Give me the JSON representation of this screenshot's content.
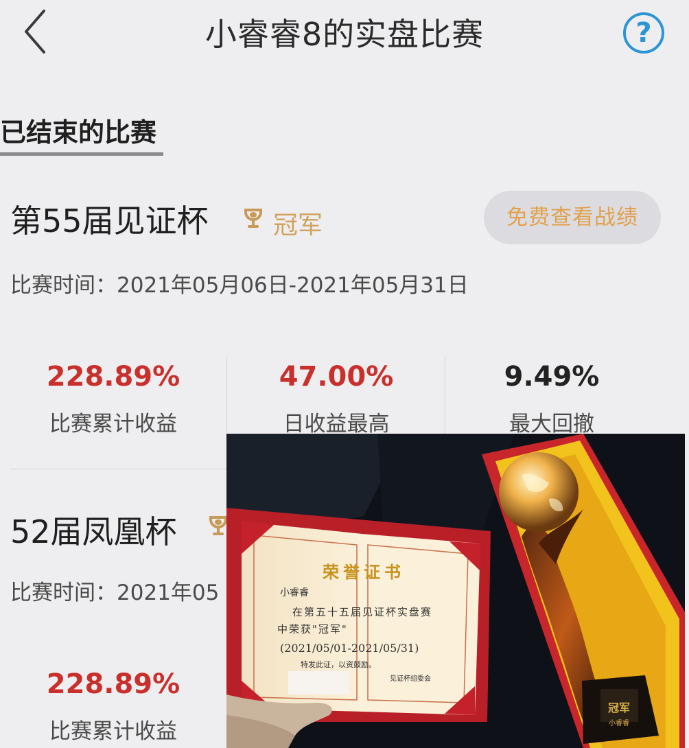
{
  "header": {
    "title": "小睿睿8的实盘比赛",
    "help_label": "?"
  },
  "tab": {
    "label": "已结束的比赛"
  },
  "contests": [
    {
      "name": "第55届见证杯",
      "badge": "冠军",
      "view_button": "免费查看战绩",
      "period_label": "比赛时间：",
      "period_value": "2021年05月06日-2021年05月31日",
      "stats": [
        {
          "value": "228.89%",
          "label": "比赛累计收益",
          "color": "#c9302c"
        },
        {
          "value": "47.00%",
          "label": "日收益最高",
          "color": "#c9302c"
        },
        {
          "value": "9.49%",
          "label": "最大回撤",
          "color": "#222222"
        }
      ]
    },
    {
      "name": "52届凤凰杯",
      "period_label": "比赛时间：",
      "period_value": "2021年05",
      "stats": [
        {
          "value": "228.89%",
          "label": "比赛累计收益",
          "color": "#c9302c"
        }
      ]
    }
  ],
  "photo": {
    "certificate": {
      "heading": "荣誉证书",
      "recipient": "小睿睿",
      "line1": "在第五十五届见证杯实盘赛",
      "line2": "中荣获\"冠军\"",
      "period": "(2021/05/01-2021/05/31)",
      "closing": "特发此证，以资鼓励。",
      "issuer": "见证杯组委会"
    },
    "trophy_plate": {
      "title": "冠军",
      "name": "小睿睿"
    }
  }
}
